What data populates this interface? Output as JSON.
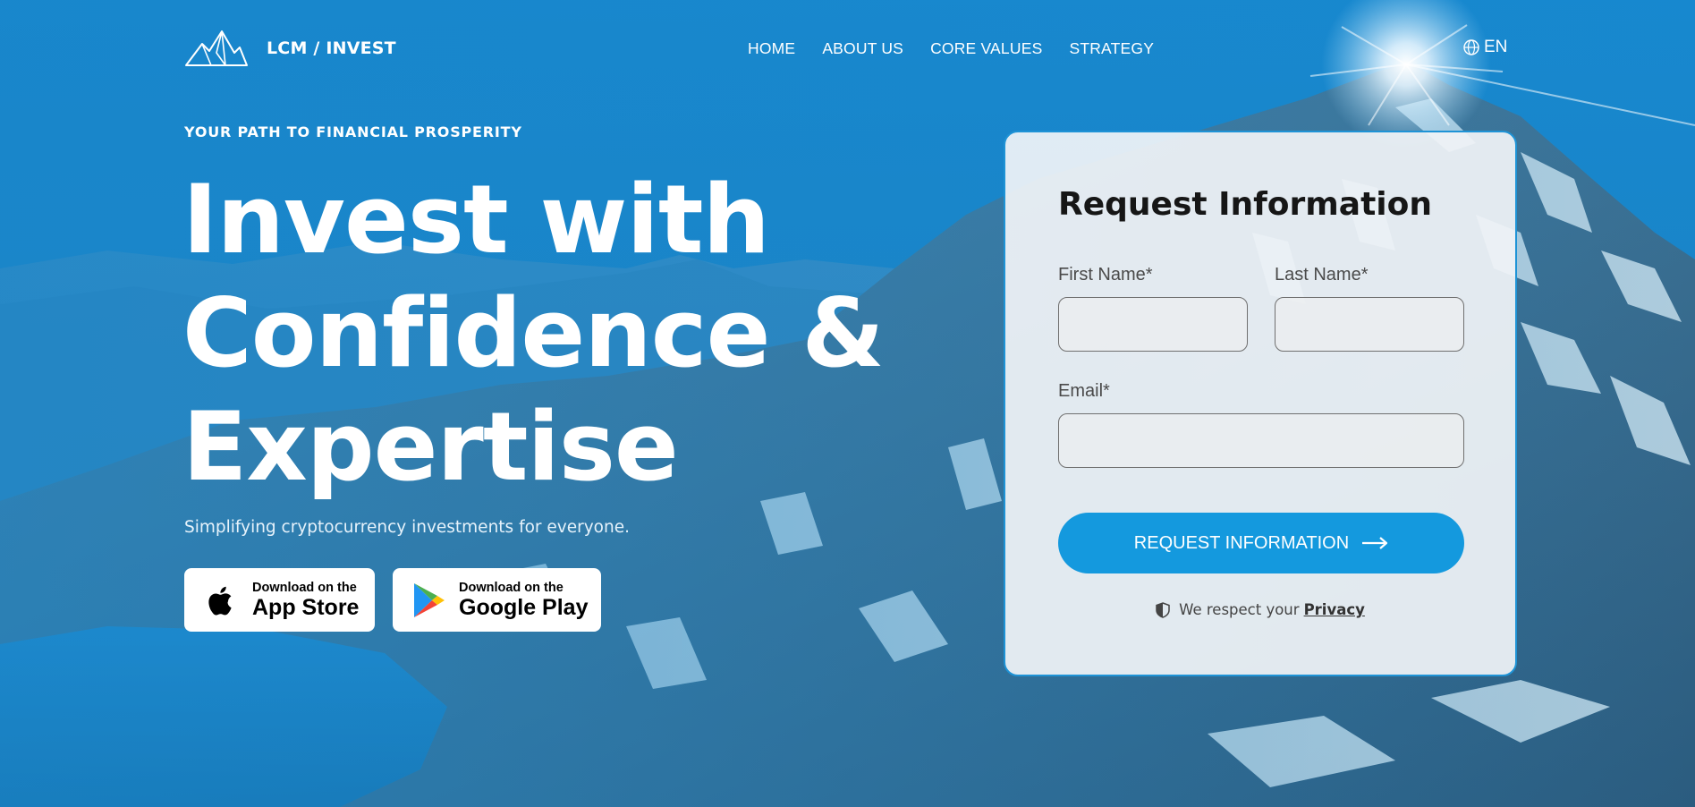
{
  "brand": {
    "name": "LCM / INVEST",
    "logo_icon": "mountain-logo-icon"
  },
  "nav": {
    "items": [
      "HOME",
      "ABOUT US",
      "CORE VALUES",
      "STRATEGY"
    ],
    "language": "EN",
    "language_icon": "globe-icon"
  },
  "hero": {
    "tagline": "YOUR PATH TO FINANCIAL PROSPERITY",
    "headline": [
      "Invest with",
      "Confidence &",
      "Expertise"
    ],
    "subline": "Simplifying cryptocurrency investments for everyone."
  },
  "stores": {
    "apple": {
      "small": "Download on the",
      "big": "App Store",
      "icon": "apple-icon"
    },
    "google": {
      "small": "Download on the",
      "big": "Google Play",
      "icon": "google-play-icon"
    }
  },
  "form": {
    "title": "Request Information",
    "first_name_label": "First Name*",
    "first_name_value": "",
    "last_name_label": "Last Name*",
    "last_name_value": "",
    "email_label": "Email*",
    "email_value": "",
    "submit_label": "REQUEST INFORMATION",
    "submit_icon": "arrow-right-icon",
    "privacy_text": "We respect your",
    "privacy_link": "Privacy",
    "privacy_icon": "shield-icon"
  },
  "colors": {
    "accent": "#1499de",
    "sky": "#1a86c9",
    "card_border": "#1e93d6"
  }
}
